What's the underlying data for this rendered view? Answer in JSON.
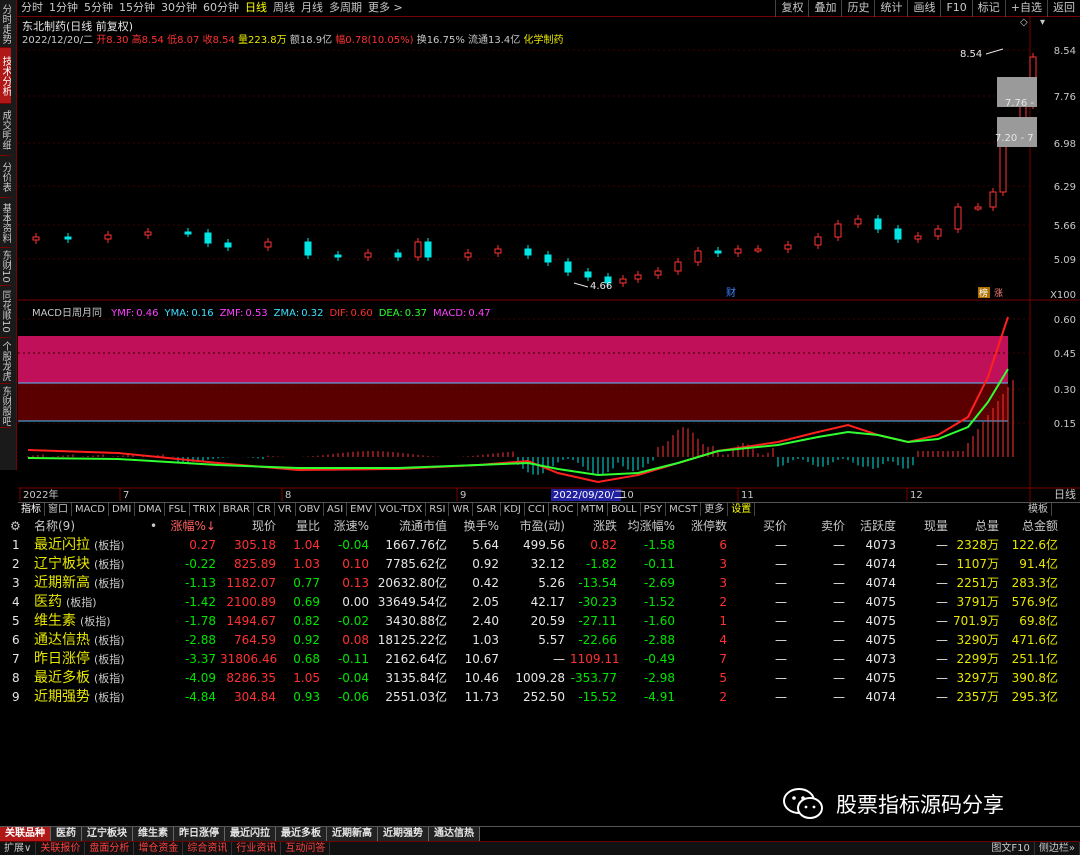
{
  "left_tabs": [
    {
      "label": "分时走势"
    },
    {
      "label": "技术分析",
      "active": true
    },
    {
      "label": "成交明细"
    },
    {
      "label": "分价表"
    },
    {
      "label": "基本资料"
    },
    {
      "label": "东财10"
    },
    {
      "label": "同花顺10"
    },
    {
      "label": "个股龙虎"
    },
    {
      "label": "东财股吧"
    }
  ],
  "period_tabs": [
    "分时",
    "1分钟",
    "5分钟",
    "15分钟",
    "30分钟",
    "60分钟",
    "日线",
    "周线",
    "月线",
    "多周期",
    "更多 >"
  ],
  "active_period": "日线",
  "toolbar_buttons": [
    "复权",
    "叠加",
    "历史",
    "统计",
    "画线",
    "F10",
    "标记",
    "+自选",
    "返回"
  ],
  "stock": {
    "title": "东北制药(日线 前复权)",
    "date": "2022/12/20/二",
    "open_label": "开",
    "open": "8.30",
    "high_label": "高",
    "high": "8.54",
    "low_label": "低",
    "low": "8.07",
    "close_label": "收",
    "close": "8.54",
    "vol_label": "量",
    "vol": "223.8万",
    "amount_label": "额",
    "amount": "18.9亿",
    "change_label": "幅",
    "change": "0.78(10.05%)",
    "turnover_label": "换",
    "turnover": "16.75%",
    "float_label": "流通",
    "float": "13.4亿",
    "sector": "化学制药"
  },
  "price_axis": [
    "8.54",
    "7.76",
    "6.98",
    "6.29",
    "5.66",
    "5.09"
  ],
  "price_annotations": {
    "high": "8.54",
    "low": "4.66",
    "range1": "7.76 -",
    "range2": "7.20 - 7"
  },
  "badges": {
    "cai": "财",
    "bang": "榜",
    "zhang": "涨"
  },
  "multiplier": "X100",
  "macd": {
    "title": "MACD日周月同",
    "params": [
      {
        "k": "YMF:",
        "v": "0.46",
        "color": "#ff40ff"
      },
      {
        "k": "YMA:",
        "v": "0.16",
        "color": "#40e0ff"
      },
      {
        "k": "ZMF:",
        "v": "0.53",
        "color": "#ff40ff"
      },
      {
        "k": "ZMA:",
        "v": "0.32",
        "color": "#40e0ff"
      },
      {
        "k": "DIF:",
        "v": "0.60",
        "color": "#ff3030"
      },
      {
        "k": "DEA:",
        "v": "0.37",
        "color": "#30ff30"
      },
      {
        "k": "MACD:",
        "v": "0.47",
        "color": "#ff40ff"
      }
    ],
    "axis": [
      "0.60",
      "0.45",
      "0.30",
      "0.15"
    ]
  },
  "time_axis": [
    "2022年",
    "7",
    "8",
    "9",
    "10",
    "11",
    "12"
  ],
  "time_cursor": "2022/09/20/二",
  "right_label": "日线",
  "indicator_tabs": [
    "指标",
    "窗口",
    "MACD",
    "DMI",
    "DMA",
    "FSL",
    "TRIX",
    "BRAR",
    "CR",
    "VR",
    "OBV",
    "ASI",
    "EMV",
    "VOL-TDX",
    "RSI",
    "WR",
    "SAR",
    "KDJ",
    "CCI",
    "ROC",
    "MTM",
    "BOLL",
    "PSY",
    "MCST",
    "更多",
    "设置"
  ],
  "template_label": "模板",
  "table": {
    "headers": [
      "名称(9)",
      "•",
      "涨幅%↓",
      "现价",
      "量比",
      "涨速%",
      "流通市值",
      "换手%",
      "市盈(动)",
      "涨跌",
      "均涨幅%",
      "涨停数",
      "买价",
      "卖价",
      "活跃度",
      "现量",
      "总量",
      "总金额"
    ],
    "rows": [
      {
        "idx": "1",
        "name": "最近闪拉",
        "tag": "(板指)",
        "chg": "0.27",
        "price": "305.18",
        "vr": "1.04",
        "spd": "-0.04",
        "fmv": "1667.76亿",
        "to": "5.64",
        "pe": "499.56",
        "diff": "0.82",
        "avg": "-1.58",
        "lim": "6",
        "bid": "—",
        "ask": "—",
        "act": "4073",
        "cur": "—",
        "vol": "2328万",
        "amt": "122.6亿"
      },
      {
        "idx": "2",
        "name": "辽宁板块",
        "tag": "(板指)",
        "chg": "-0.22",
        "price": "825.89",
        "vr": "1.03",
        "spd": "0.10",
        "fmv": "7785.62亿",
        "to": "0.92",
        "pe": "32.12",
        "diff": "-1.82",
        "avg": "-0.11",
        "lim": "3",
        "bid": "—",
        "ask": "—",
        "act": "4074",
        "cur": "—",
        "vol": "1107万",
        "amt": "91.4亿"
      },
      {
        "idx": "3",
        "name": "近期新高",
        "tag": "(板指)",
        "chg": "-1.13",
        "price": "1182.07",
        "vr": "0.77",
        "spd": "0.13",
        "fmv": "20632.80亿",
        "to": "0.42",
        "pe": "5.26",
        "diff": "-13.54",
        "avg": "-2.69",
        "lim": "3",
        "bid": "—",
        "ask": "—",
        "act": "4074",
        "cur": "—",
        "vol": "2251万",
        "amt": "283.3亿"
      },
      {
        "idx": "4",
        "name": "医药",
        "tag": "(板指)",
        "chg": "-1.42",
        "price": "2100.89",
        "vr": "0.69",
        "spd": "0.00",
        "fmv": "33649.54亿",
        "to": "2.05",
        "pe": "42.17",
        "diff": "-30.23",
        "avg": "-1.52",
        "lim": "2",
        "bid": "—",
        "ask": "—",
        "act": "4075",
        "cur": "—",
        "vol": "3791万",
        "amt": "576.9亿"
      },
      {
        "idx": "5",
        "name": "维生素",
        "tag": "(板指)",
        "chg": "-1.78",
        "price": "1494.67",
        "vr": "0.82",
        "spd": "-0.02",
        "fmv": "3430.88亿",
        "to": "2.40",
        "pe": "20.59",
        "diff": "-27.11",
        "avg": "-1.60",
        "lim": "1",
        "bid": "—",
        "ask": "—",
        "act": "4075",
        "cur": "—",
        "vol": "701.9万",
        "amt": "69.8亿"
      },
      {
        "idx": "6",
        "name": "通达信热",
        "tag": "(板指)",
        "chg": "-2.88",
        "price": "764.59",
        "vr": "0.92",
        "spd": "0.08",
        "fmv": "18125.22亿",
        "to": "1.03",
        "pe": "5.57",
        "diff": "-22.66",
        "avg": "-2.88",
        "lim": "4",
        "bid": "—",
        "ask": "—",
        "act": "4075",
        "cur": "—",
        "vol": "3290万",
        "amt": "471.6亿"
      },
      {
        "idx": "7",
        "name": "昨日涨停",
        "tag": "(板指)",
        "chg": "-3.37",
        "price": "31806.46",
        "vr": "0.68",
        "spd": "-0.11",
        "fmv": "2162.64亿",
        "to": "10.67",
        "pe": "—",
        "diff": "1109.11",
        "avg": "-0.49",
        "lim": "7",
        "bid": "—",
        "ask": "—",
        "act": "4073",
        "cur": "—",
        "vol": "2299万",
        "amt": "251.1亿"
      },
      {
        "idx": "8",
        "name": "最近多板",
        "tag": "(板指)",
        "chg": "-4.09",
        "price": "8286.35",
        "vr": "1.05",
        "spd": "-0.04",
        "fmv": "3135.84亿",
        "to": "10.46",
        "pe": "1009.28",
        "diff": "-353.77",
        "avg": "-2.98",
        "lim": "5",
        "bid": "—",
        "ask": "—",
        "act": "4075",
        "cur": "—",
        "vol": "3297万",
        "amt": "390.8亿"
      },
      {
        "idx": "9",
        "name": "近期强势",
        "tag": "(板指)",
        "chg": "-4.84",
        "price": "304.84",
        "vr": "0.93",
        "spd": "-0.06",
        "fmv": "2551.03亿",
        "to": "11.73",
        "pe": "252.50",
        "diff": "-15.52",
        "avg": "-4.91",
        "lim": "2",
        "bid": "—",
        "ask": "—",
        "act": "4074",
        "cur": "—",
        "vol": "2357万",
        "amt": "295.3亿"
      }
    ]
  },
  "watermark": "股票指标源码分享",
  "sector_tabs": [
    "关联品种",
    "医药",
    "辽宁板块",
    "维生素",
    "昨日涨停",
    "最近闪拉",
    "最近多板",
    "近期新高",
    "近期强势",
    "通达信热"
  ],
  "status_items": [
    "扩展∨",
    "关联报价",
    "盘面分析",
    "增仓资金",
    "综合资讯",
    "行业资讯",
    "互动问答"
  ],
  "status_right": [
    "图文F10",
    "侧边栏»"
  ],
  "colors": {
    "up": "#ff3232",
    "down": "#00e6e6",
    "dif": "#ff2020",
    "dea": "#30ff30",
    "grid": "#7a0000",
    "band1": "#c0105a",
    "band2": "#5a0000"
  }
}
